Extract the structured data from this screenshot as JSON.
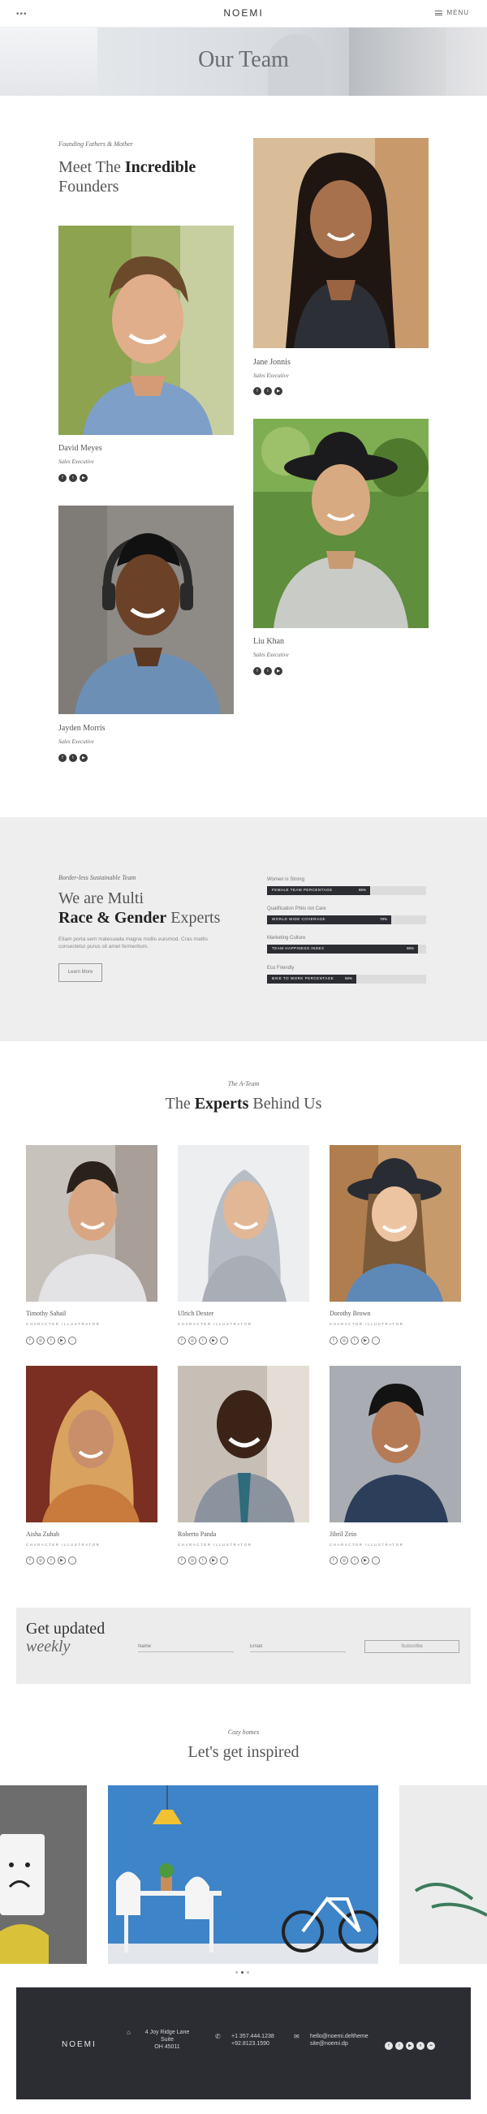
{
  "header": {
    "logo": "NOEMI",
    "menu_label": "MENU",
    "dots": "•••"
  },
  "hero": {
    "title": "Our Team"
  },
  "founders": {
    "eyebrow": "Founding Fathers & Mother",
    "heading_line1_pre": "Meet The ",
    "heading_line1_bold": "Incredible",
    "heading_line2": "Founders",
    "members": [
      {
        "name": "Jane Jonnis",
        "role": "Sales Executive"
      },
      {
        "name": "David Meyes",
        "role": "Sales Executive"
      },
      {
        "name": "Liu Khan",
        "role": "Sales Executive"
      },
      {
        "name": "Jayden Morris",
        "role": "Sales Executive"
      }
    ]
  },
  "skills": {
    "eyebrow": "Border-less Sustainable Team",
    "heading_line1": "We are Multi",
    "heading_bold": "Race & Gender",
    "heading_tail": " Experts",
    "description": "Etiam porta sem malesuada magna mollis euismod. Cras mattis consectetur purus sit amet fermentum.",
    "button_label": "Learn More",
    "bars": [
      {
        "label": "Women is Strong",
        "inner": "Female Team Percentage",
        "percent": 0.65,
        "percent_text": "65%"
      },
      {
        "label": "Qualification Philo not Care",
        "inner": "World Wide Coverage",
        "percent": 0.78,
        "percent_text": "78%"
      },
      {
        "label": "Marketing Culture",
        "inner": "Team Happiness Index",
        "percent": 0.95,
        "percent_text": "95%"
      },
      {
        "label": "Eco Friendly",
        "inner": "Bike to Work Percentage",
        "percent": 0.56,
        "percent_text": "56%"
      }
    ]
  },
  "experts": {
    "eyebrow": "The A-Team",
    "heading_pre": "The ",
    "heading_bold": "Experts",
    "heading_tail": " Behind Us",
    "members": [
      {
        "name": "Timothy Sahail",
        "role": "Character Illustrator"
      },
      {
        "name": "Ulrich Dexter",
        "role": "Character Illustrator"
      },
      {
        "name": "Dorothy Brown",
        "role": "Character Illustrator"
      },
      {
        "name": "Aisha Zuhab",
        "role": "Character Illustrator"
      },
      {
        "name": "Roberto Panda",
        "role": "Character Illustrator"
      },
      {
        "name": "Jibril Zein",
        "role": "Character Illustrator"
      }
    ]
  },
  "newsletter": {
    "title_line1": "Get updated",
    "title_line2": "weekly",
    "name_placeholder": "Name",
    "email_placeholder": "Email",
    "button_label": "Subscribe"
  },
  "inspired": {
    "eyebrow": "Cozy homes",
    "heading": "Let's get inspired"
  },
  "footer": {
    "logo": "NOEMI",
    "address_line1": "4 Joy Ridge Lane",
    "address_line2": "Suite",
    "address_line3": "OH 45011",
    "phone1": "+1 357.444.1238",
    "phone2": "+92.8123.1590",
    "email1": "hello@noemi.deltheme",
    "email2": "site@noemi.dp"
  },
  "colors": {
    "dark": "#2b2d33",
    "band": "#eeeeee"
  }
}
